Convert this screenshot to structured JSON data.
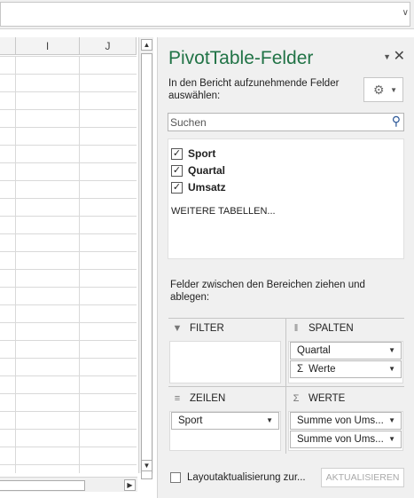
{
  "sheet": {
    "columns": [
      "I",
      "J"
    ]
  },
  "pane": {
    "title": "PivotTable-Felder",
    "subtitle": "In den Bericht aufzunehmende Felder auswählen:",
    "search_placeholder": "Suchen",
    "fields": [
      {
        "label": "Sport",
        "checked": true
      },
      {
        "label": "Quartal",
        "checked": true
      },
      {
        "label": "Umsatz",
        "checked": true
      }
    ],
    "more_tables": "WEITERE TABELLEN...",
    "drag_hint": "Felder zwischen den Bereichen ziehen und ablegen:",
    "areas": {
      "filter": {
        "label": "FILTER",
        "items": []
      },
      "columns": {
        "label": "SPALTEN",
        "items": [
          "Quartal",
          "Werte"
        ]
      },
      "rows": {
        "label": "ZEILEN",
        "items": [
          "Sport"
        ]
      },
      "values": {
        "label": "WERTE",
        "items": [
          "Summe von Ums...",
          "Summe von Ums..."
        ]
      }
    },
    "defer_update_label": "Layoutaktualisierung zur...",
    "update_button": "AKTUALISIEREN",
    "accent_color": "#217346"
  },
  "icons": {
    "check": "✓",
    "sigma": "Σ"
  }
}
